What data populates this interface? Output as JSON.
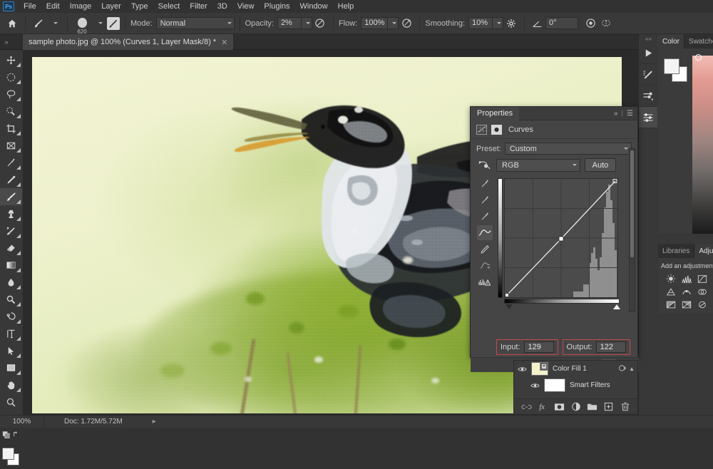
{
  "app": {
    "logo": "Ps"
  },
  "menubar": {
    "items": [
      "File",
      "Edit",
      "Image",
      "Layer",
      "Type",
      "Select",
      "Filter",
      "3D",
      "View",
      "Plugins",
      "Window",
      "Help"
    ]
  },
  "options_bar": {
    "home_icon": "home-icon",
    "tool_icon": "brush-tool-icon",
    "brush_size": "620",
    "brush_preset_icon": "brush-preset-icon",
    "mode_label": "Mode:",
    "mode_value": "Normal",
    "opacity_label": "Opacity:",
    "opacity_value": "2%",
    "opacity_pressure_icon": "pressure-opacity-icon",
    "flow_label": "Flow:",
    "flow_value": "100%",
    "airbrush_icon": "airbrush-icon",
    "smoothing_label": "Smoothing:",
    "smoothing_value": "10%",
    "smoothing_options_icon": "gear-icon",
    "angle_icon": "angle-icon",
    "angle_value": "0°",
    "pressure_size_icon": "pressure-size-icon",
    "symmetry_icon": "symmetry-butterfly-icon"
  },
  "tabbar": {
    "expander_icon": "expand-arrows-icon",
    "document_title": "sample photo.jpg @ 100% (Curves 1, Layer Mask/8) *",
    "close_icon": "close-icon"
  },
  "toolbar": {
    "tools": [
      {
        "name": "move-tool",
        "active": false
      },
      {
        "name": "marquee-tool",
        "active": false
      },
      {
        "name": "lasso-tool",
        "active": false
      },
      {
        "name": "quick-selection-tool",
        "active": false
      },
      {
        "name": "crop-tool",
        "active": false
      },
      {
        "name": "frame-tool",
        "active": false
      },
      {
        "name": "eyedropper-tool",
        "active": false
      },
      {
        "name": "healing-brush-tool",
        "active": false
      },
      {
        "name": "brush-tool",
        "active": true
      },
      {
        "name": "clone-stamp-tool",
        "active": false
      },
      {
        "name": "history-brush-tool",
        "active": false
      },
      {
        "name": "eraser-tool",
        "active": false
      },
      {
        "name": "gradient-tool",
        "active": false
      },
      {
        "name": "blur-tool",
        "active": false
      },
      {
        "name": "dodge-tool",
        "active": false
      },
      {
        "name": "pen-tool",
        "active": false
      },
      {
        "name": "type-tool",
        "active": false
      },
      {
        "name": "path-selection-tool",
        "active": false
      },
      {
        "name": "rectangle-tool",
        "active": false
      },
      {
        "name": "hand-tool",
        "active": false
      },
      {
        "name": "zoom-tool",
        "active": false
      },
      {
        "name": "edit-toolbar-tool",
        "active": false
      }
    ],
    "swap_colors_icon": "swap-colors-icon",
    "default_colors_icon": "default-colors-icon"
  },
  "canvas": {
    "image_alt": "watercolor painting of a heron standing on green foliage",
    "colors": {
      "paper": "#eef1cb",
      "foliage": "#8aad36",
      "bird_dark": "#1c1c1c",
      "bird_light": "#d9dee1",
      "beak": "#d99a35"
    }
  },
  "statusbar": {
    "zoom": "100%",
    "doc_info": "Doc: 1.72M/5.72M",
    "expand_icon": "chevron-right-icon"
  },
  "dock_rail": {
    "buttons": [
      {
        "name": "play-actions-icon",
        "active": false
      },
      {
        "name": "brush-settings-icon",
        "active": false
      },
      {
        "name": "brush-presets-icon",
        "active": false
      },
      {
        "name": "adjustments-sliders-icon",
        "active": true
      }
    ]
  },
  "right_panels": {
    "color_group": {
      "tabs": [
        {
          "label": "Color",
          "selected": true
        },
        {
          "label": "Swatches",
          "selected": false
        }
      ],
      "foreground_swatch": "#f4f4f4",
      "background_swatch": "#ffffff",
      "ramp_icon": "color-ramp"
    },
    "library_group": {
      "tabs": [
        {
          "label": "Libraries",
          "selected": false
        },
        {
          "label": "Adjustments",
          "selected": true
        }
      ],
      "title": "Add an adjustment",
      "icons": [
        "brightness-contrast-icon",
        "levels-icon",
        "curves-icon",
        "exposure-icon",
        "vibrance-icon",
        "hue-saturation-icon",
        "color-balance-icon",
        "black-white-icon",
        "photo-filter-icon"
      ]
    }
  },
  "properties_panel": {
    "tab_label": "Properties",
    "collapse_icon": "double-chevron-right-icon",
    "menu_icon": "panel-menu-icon",
    "adjustment_icon": "curves-adjustment-icon",
    "mask_icon": "layer-mask-icon",
    "adjustment_name": "Curves",
    "preset_label": "Preset:",
    "preset_value": "Custom",
    "onimage_icon": "on-image-adjustment-icon",
    "channel_value": "RGB",
    "auto_label": "Auto",
    "curve_tools": [
      {
        "name": "black-point-eyedropper-icon",
        "active": false
      },
      {
        "name": "gray-point-eyedropper-icon",
        "active": false
      },
      {
        "name": "white-point-eyedropper-icon",
        "active": false
      },
      {
        "name": "curve-point-tool-icon",
        "active": true
      },
      {
        "name": "pencil-draw-curve-icon",
        "active": false
      },
      {
        "name": "smooth-curve-icon",
        "active": false
      },
      {
        "name": "histogram-options-icon",
        "active": false
      }
    ],
    "input_label": "Input:",
    "input_value": "129",
    "output_label": "Output:",
    "output_value": "122",
    "highlight_color": "#c4484a",
    "footer_buttons": [
      {
        "name": "clip-to-layer-icon",
        "active": false
      },
      {
        "name": "toggle-before-after-icon",
        "active": false
      },
      {
        "name": "reset-adjustment-icon",
        "active": false
      },
      {
        "name": "toggle-layer-visibility-icon",
        "active": true
      },
      {
        "name": "delete-adjustment-icon",
        "active": false
      }
    ],
    "curve_points": [
      {
        "input": 0,
        "output": 0
      },
      {
        "input": 129,
        "output": 122
      },
      {
        "input": 255,
        "output": 255
      }
    ],
    "shadow_slider": 0,
    "highlight_slider": 255
  },
  "layers_panel": {
    "rows": [
      {
        "name": "Color Fill 1",
        "visible": true,
        "thumb": "#f2f3cd",
        "has_mask": true
      },
      {
        "name": "Smart Filters",
        "visible": true,
        "thumb": "#ffffff",
        "has_mask": false
      }
    ],
    "footer_buttons": [
      "link-layers-icon",
      "layer-style-icon",
      "add-layer-mask-icon",
      "new-adjustment-layer-icon",
      "new-group-icon",
      "new-layer-icon",
      "delete-layer-icon"
    ]
  }
}
